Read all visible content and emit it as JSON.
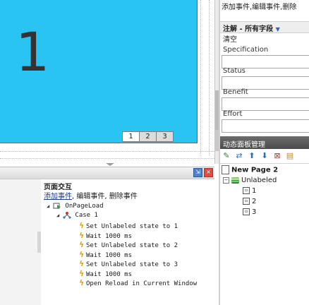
{
  "canvas": {
    "state_number": "1",
    "page_tabs": [
      "1",
      "2",
      "3"
    ],
    "active_tab_index": 0,
    "panel_color": "#29c4f2"
  },
  "interaction_pane": {
    "title": "页面交互",
    "add_event": "添加事件",
    "edit_event": "编辑事件",
    "delete_event": "删除事件",
    "event_name": "OnPageLoad",
    "case_name": "Case 1",
    "actions": [
      "Set Unlabeled state to 1",
      "Wait 1000 ms",
      "Set Unlabeled state to 2",
      "Wait 1000 ms",
      "Set Unlabeled state to 3",
      "Wait 1000 ms",
      "Open Reload in Current Window"
    ]
  },
  "right_top": {
    "actions_text": "添加事件,编辑事件,删除"
  },
  "notes": {
    "title": "注解 - 所有字段",
    "clear": "清空",
    "fields": [
      "Specification",
      "Status",
      "Benefit",
      "Effort"
    ]
  },
  "dynamic_panel_manager": {
    "title": "动态面板管理",
    "page_name": "New Page 2",
    "panel_name": "Unlabeled",
    "states": [
      "1",
      "2",
      "3"
    ]
  },
  "colors": {
    "accent_blue": "#29c4f2",
    "link": "#1e3a8c",
    "bolt": "#e3a21a"
  }
}
